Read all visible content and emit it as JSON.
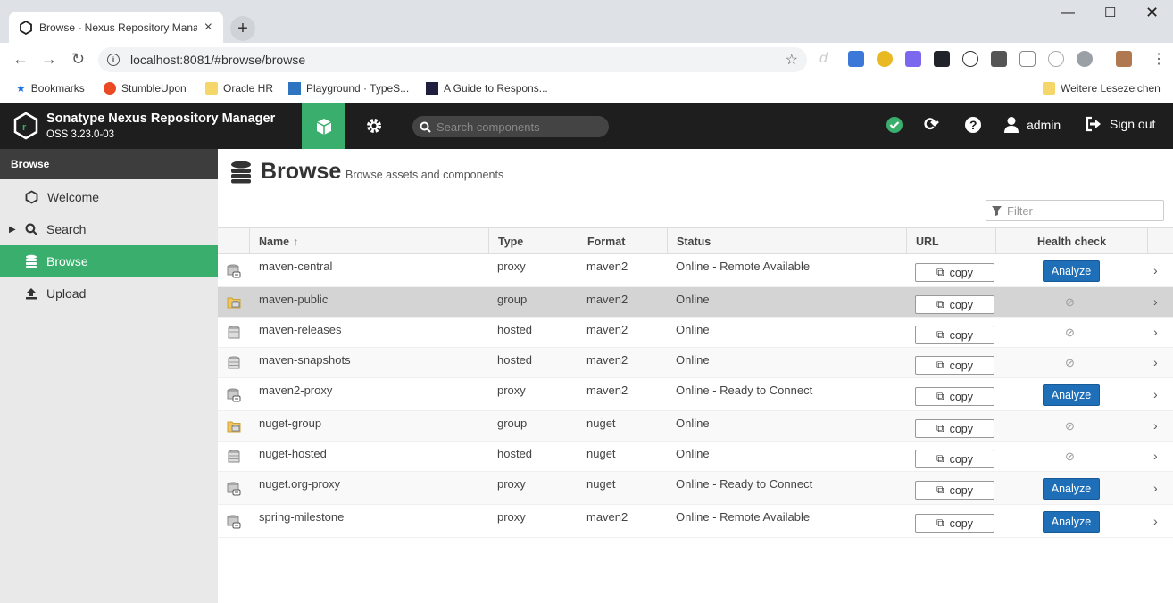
{
  "browser": {
    "tab_title": "Browse - Nexus Repository Mana",
    "url": "localhost:8081/#browse/browse",
    "bookmarks": [
      "Bookmarks",
      "StumbleUpon",
      "Oracle HR",
      "Playground · TypeS...",
      "A Guide to Respons...",
      "Weitere Lesezeichen"
    ]
  },
  "header": {
    "product": "Sonatype Nexus Repository Manager",
    "version": "OSS 3.23.0-03",
    "search_placeholder": "Search components",
    "user": "admin",
    "signout": "Sign out"
  },
  "sidebar": {
    "heading": "Browse",
    "items": [
      {
        "label": "Welcome",
        "icon": "hexagon-icon"
      },
      {
        "label": "Search",
        "icon": "search-icon"
      },
      {
        "label": "Browse",
        "icon": "database-icon"
      },
      {
        "label": "Upload",
        "icon": "upload-icon"
      }
    ]
  },
  "main": {
    "title": "Browse",
    "subtitle": "Browse assets and components",
    "filter_placeholder": "Filter",
    "columns": {
      "name": "Name",
      "type": "Type",
      "format": "Format",
      "status": "Status",
      "url": "URL",
      "health": "Health check"
    },
    "copy_label": "copy",
    "analyze_label": "Analyze",
    "rows": [
      {
        "name": "maven-central",
        "type": "proxy",
        "format": "maven2",
        "status": "Online - Remote Available",
        "health": "analyze"
      },
      {
        "name": "maven-public",
        "type": "group",
        "format": "maven2",
        "status": "Online",
        "health": "none"
      },
      {
        "name": "maven-releases",
        "type": "hosted",
        "format": "maven2",
        "status": "Online",
        "health": "none"
      },
      {
        "name": "maven-snapshots",
        "type": "hosted",
        "format": "maven2",
        "status": "Online",
        "health": "none"
      },
      {
        "name": "maven2-proxy",
        "type": "proxy",
        "format": "maven2",
        "status": "Online - Ready to Connect",
        "health": "analyze"
      },
      {
        "name": "nuget-group",
        "type": "group",
        "format": "nuget",
        "status": "Online",
        "health": "none"
      },
      {
        "name": "nuget-hosted",
        "type": "hosted",
        "format": "nuget",
        "status": "Online",
        "health": "none"
      },
      {
        "name": "nuget.org-proxy",
        "type": "proxy",
        "format": "nuget",
        "status": "Online - Ready to Connect",
        "health": "analyze"
      },
      {
        "name": "spring-milestone",
        "type": "proxy",
        "format": "maven2",
        "status": "Online - Remote Available",
        "health": "analyze"
      }
    ]
  },
  "colors": {
    "accent": "#3aaf6d",
    "header_bg": "#1e1e1e",
    "analyze": "#1e6fb8"
  }
}
